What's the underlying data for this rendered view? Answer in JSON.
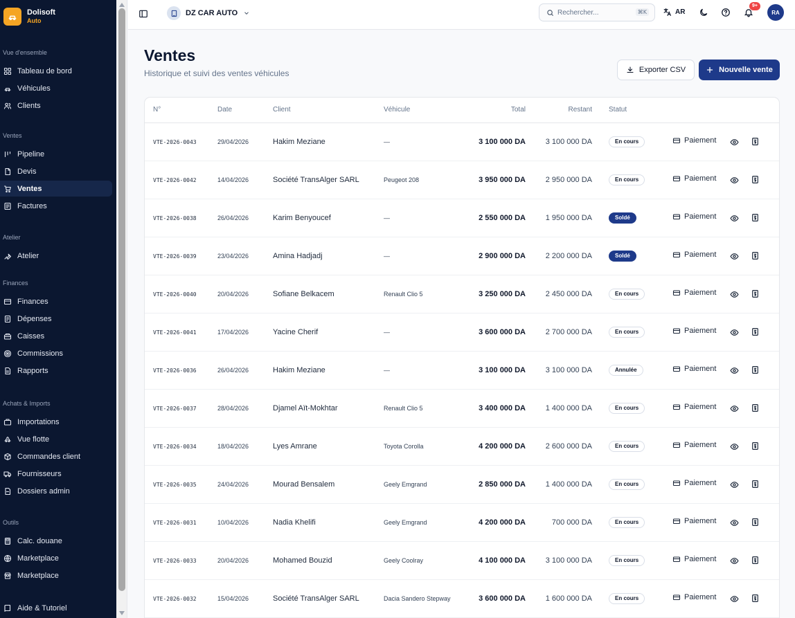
{
  "brand": {
    "name": "Dolisoft",
    "sub": "Auto"
  },
  "sidebar": {
    "groups": [
      {
        "title": "Vue d'ensemble",
        "items": [
          {
            "label": "Tableau de bord",
            "icon": "dashboard-icon"
          },
          {
            "label": "Véhicules",
            "icon": "car-icon"
          },
          {
            "label": "Clients",
            "icon": "users-icon"
          }
        ]
      },
      {
        "title": "Ventes",
        "items": [
          {
            "label": "Pipeline",
            "icon": "pipeline-icon"
          },
          {
            "label": "Devis",
            "icon": "document-icon"
          },
          {
            "label": "Ventes",
            "icon": "cart-icon",
            "active": true
          },
          {
            "label": "Factures",
            "icon": "invoice-icon"
          }
        ]
      },
      {
        "title": "Atelier",
        "items": [
          {
            "label": "Atelier",
            "icon": "wrench-icon"
          }
        ]
      },
      {
        "title": "Finances",
        "items": [
          {
            "label": "Finances",
            "icon": "wallet-icon"
          },
          {
            "label": "Dépenses",
            "icon": "expense-icon"
          },
          {
            "label": "Caisses",
            "icon": "cashbox-icon"
          },
          {
            "label": "Commissions",
            "icon": "target-icon"
          },
          {
            "label": "Rapports",
            "icon": "report-icon"
          }
        ]
      },
      {
        "title": "Achats & Imports",
        "items": [
          {
            "label": "Importations",
            "icon": "import-icon"
          },
          {
            "label": "Vue flotte",
            "icon": "fleet-icon"
          },
          {
            "label": "Commandes client",
            "icon": "package-icon"
          },
          {
            "label": "Fournisseurs",
            "icon": "truck-icon"
          },
          {
            "label": "Dossiers admin",
            "icon": "folder-icon"
          }
        ]
      },
      {
        "title": "Outils",
        "items": [
          {
            "label": "Calc. douane",
            "icon": "calculator-icon"
          },
          {
            "label": "Marketplace",
            "icon": "globe-icon"
          },
          {
            "label": "Marketplace",
            "icon": "store-icon"
          }
        ]
      }
    ],
    "footer": {
      "label": "Aide & Tutoriel",
      "icon": "book-icon"
    }
  },
  "topbar": {
    "company": "DZ CAR AUTO",
    "search_placeholder": "Rechercher...",
    "search_shortcut": "⌘K",
    "language": "AR",
    "notification_count": "9+",
    "user_initials": "RA"
  },
  "page": {
    "title": "Ventes",
    "subtitle": "Historique et suivi des ventes véhicules",
    "export_label": "Exporter CSV",
    "new_label": "Nouvelle vente"
  },
  "table": {
    "headers": {
      "num": "N°",
      "date": "Date",
      "client": "Client",
      "vehicle": "Véhicule",
      "total": "Total",
      "remaining": "Restant",
      "status": "Statut"
    },
    "payment_label": "Paiement",
    "rows": [
      {
        "num": "VTE-2026-0043",
        "date": "29/04/2026",
        "client": "Hakim Meziane",
        "vehicle": "—",
        "total": "3 100 000 DA",
        "remaining": "3 100 000 DA",
        "status": "En cours",
        "solde": false
      },
      {
        "num": "VTE-2026-0042",
        "date": "14/04/2026",
        "client": "Société TransAlger SARL",
        "vehicle": "Peugeot 208",
        "total": "3 950 000 DA",
        "remaining": "2 950 000 DA",
        "status": "En cours",
        "solde": false
      },
      {
        "num": "VTE-2026-0038",
        "date": "26/04/2026",
        "client": "Karim Benyoucef",
        "vehicle": "—",
        "total": "2 550 000 DA",
        "remaining": "1 950 000 DA",
        "status": "Soldé",
        "solde": true
      },
      {
        "num": "VTE-2026-0039",
        "date": "23/04/2026",
        "client": "Amina Hadjadj",
        "vehicle": "—",
        "total": "2 900 000 DA",
        "remaining": "2 200 000 DA",
        "status": "Soldé",
        "solde": true
      },
      {
        "num": "VTE-2026-0040",
        "date": "20/04/2026",
        "client": "Sofiane Belkacem",
        "vehicle": "Renault Clio 5",
        "total": "3 250 000 DA",
        "remaining": "2 450 000 DA",
        "status": "En cours",
        "solde": false
      },
      {
        "num": "VTE-2026-0041",
        "date": "17/04/2026",
        "client": "Yacine Cherif",
        "vehicle": "—",
        "total": "3 600 000 DA",
        "remaining": "2 700 000 DA",
        "status": "En cours",
        "solde": false
      },
      {
        "num": "VTE-2026-0036",
        "date": "26/04/2026",
        "client": "Hakim Meziane",
        "vehicle": "—",
        "total": "3 100 000 DA",
        "remaining": "3 100 000 DA",
        "status": "Annulée",
        "solde": false
      },
      {
        "num": "VTE-2026-0037",
        "date": "28/04/2026",
        "client": "Djamel Aït-Mokhtar",
        "vehicle": "Renault Clio 5",
        "total": "3 400 000 DA",
        "remaining": "1 400 000 DA",
        "status": "En cours",
        "solde": false
      },
      {
        "num": "VTE-2026-0034",
        "date": "18/04/2026",
        "client": "Lyes Amrane",
        "vehicle": "Toyota Corolla",
        "total": "4 200 000 DA",
        "remaining": "2 600 000 DA",
        "status": "En cours",
        "solde": false
      },
      {
        "num": "VTE-2026-0035",
        "date": "24/04/2026",
        "client": "Mourad Bensalem",
        "vehicle": "Geely Emgrand",
        "total": "2 850 000 DA",
        "remaining": "1 400 000 DA",
        "status": "En cours",
        "solde": false
      },
      {
        "num": "VTE-2026-0031",
        "date": "10/04/2026",
        "client": "Nadia Khelifi",
        "vehicle": "Geely Emgrand",
        "total": "4 200 000 DA",
        "remaining": "700 000 DA",
        "status": "En cours",
        "solde": false
      },
      {
        "num": "VTE-2026-0033",
        "date": "20/04/2026",
        "client": "Mohamed Bouzid",
        "vehicle": "Geely Coolray",
        "total": "4 100 000 DA",
        "remaining": "3 100 000 DA",
        "status": "En cours",
        "solde": false
      },
      {
        "num": "VTE-2026-0032",
        "date": "15/04/2026",
        "client": "Société TransAlger SARL",
        "vehicle": "Dacia Sandero Stepway",
        "total": "3 600 000 DA",
        "remaining": "1 600 000 DA",
        "status": "En cours",
        "solde": false
      }
    ]
  },
  "colors": {
    "sidebar_bg": "#0b1730",
    "accent": "#1e3a8a",
    "brand": "#f5a524",
    "badge": "#ef4444"
  }
}
